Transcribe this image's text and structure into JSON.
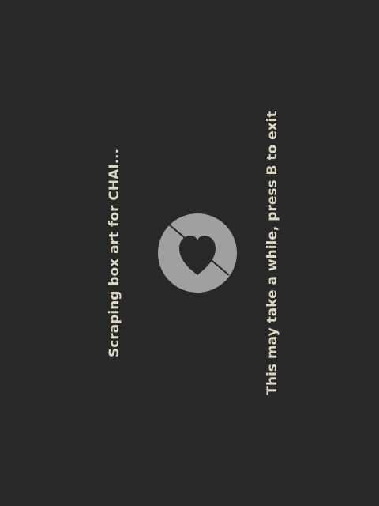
{
  "loading": {
    "status": "Scraping box art for CHAI...",
    "hint": "This may take a while, press B to exit",
    "logo_icon": "heart-badge-icon"
  },
  "colors": {
    "background": "#282828",
    "text": "#ddd6c1",
    "logo_fill": "#a0a0a0"
  }
}
